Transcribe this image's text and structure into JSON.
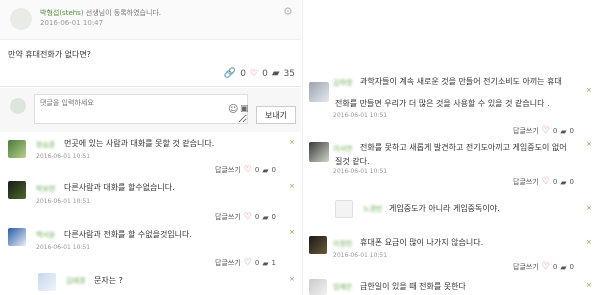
{
  "post": {
    "author": "박형섭(stehs)",
    "author_rest": " 선생님이 등록하였습니다.",
    "date": "2016-06-01 10:47",
    "body": "만약 휴대전화가 없다면?",
    "link_count": "0",
    "heart_count": "0",
    "comment_count": "35"
  },
  "compose": {
    "placeholder": "댓글을 입력하세요",
    "send_label": "보내기"
  },
  "left_comments": [
    {
      "nick": "정승훈",
      "text": "먼곳에 있는 사람과 대화를 못할 것 같습니다.",
      "date": "2016-06-01 10:51",
      "reply": "답글쓰기",
      "hearts": "0",
      "likes": "0"
    },
    {
      "nick": "박보현",
      "text": "다른사람과 대화를 할수없습니다.",
      "date": "2016-06-01 10:51",
      "reply": "답글쓰기",
      "hearts": "0",
      "likes": "0"
    },
    {
      "nick": "백서윤",
      "text": "다른사람과 전화를 할 수없을것입니다.",
      "date": "2016-06-01 10:51",
      "reply": "답글쓰기",
      "hearts": "0",
      "likes": "1"
    },
    {
      "nick": "김태경",
      "text": "문자는 ?",
      "date": "",
      "reply": "",
      "hearts": "",
      "likes": ""
    }
  ],
  "right_comments": [
    {
      "nick": "김하영",
      "text1": "과학자들이 계속 새로운 것을 만들어 전기소비도 아끼는 휴대",
      "text2": "전화를 만들면 우리가 더 많은 것을 사용할 수 있을 것 같습니다 .",
      "date": "2016-06-01 10:51",
      "reply": "답글쓰기",
      "hearts": "0",
      "likes": "0"
    },
    {
      "nick": "이서연",
      "text1": "전화를 못하고 새롭게 발견하고 전기도아끼고 게임중도이 없어",
      "text2": "질것 같다.",
      "date": "2016-06-01 10:51",
      "reply": "답글쓰기",
      "hearts": "0",
      "likes": "0"
    },
    {
      "nick": "노경빈",
      "text1": "게임중도가 아니라 게임중독이야.",
      "text2": "",
      "date": "",
      "reply": "",
      "hearts": "",
      "likes": ""
    },
    {
      "nick": "이정민",
      "text1": "휴대폰 요금이 많이 나가지 않습니다.",
      "text2": "",
      "date": "2016-06-01 10:51",
      "reply": "답글쓰기",
      "hearts": "0",
      "likes": "0"
    },
    {
      "nick": "임예은",
      "text1": "급한일이 있을 때 전화를 못한다",
      "text2": "",
      "date": "",
      "reply": "",
      "hearts": "",
      "likes": ""
    }
  ]
}
